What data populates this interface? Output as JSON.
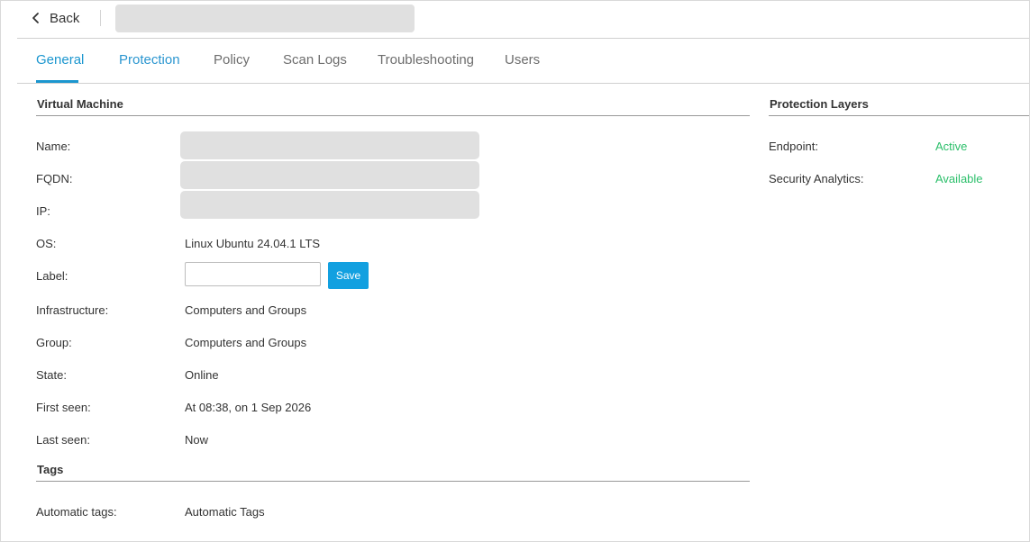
{
  "header": {
    "back_label": "Back"
  },
  "tabs": [
    {
      "label": "General"
    },
    {
      "label": "Protection"
    },
    {
      "label": "Policy"
    },
    {
      "label": "Scan Logs"
    },
    {
      "label": "Troubleshooting"
    },
    {
      "label": "Users"
    }
  ],
  "virtual_machine": {
    "title": "Virtual Machine",
    "name_label": "Name:",
    "fqdn_label": "FQDN:",
    "ip_label": "IP:",
    "os_label": "OS:",
    "os_value": "Linux Ubuntu 24.04.1 LTS",
    "label_label": "Label:",
    "label_value": "",
    "save_label": "Save",
    "infrastructure_label": "Infrastructure:",
    "infrastructure_value": "Computers and Groups",
    "group_label": "Group:",
    "group_value": "Computers and Groups",
    "state_label": "State:",
    "state_value": "Online",
    "first_seen_label": "First seen:",
    "first_seen_value": "At 08:38, on 1 Sep 2026",
    "last_seen_label": "Last seen:",
    "last_seen_value": "Now"
  },
  "tags": {
    "title": "Tags",
    "automatic_label": "Automatic tags:",
    "automatic_value": "Automatic Tags"
  },
  "protection_layers": {
    "title": "Protection Layers",
    "items": [
      {
        "label": "Endpoint:",
        "status": "Active"
      },
      {
        "label": "Security Analytics:",
        "status": "Available"
      }
    ]
  },
  "colors": {
    "accent": "#1b96cf",
    "save_button": "#12a0e0",
    "status_green": "#2bbf6a",
    "redacted_fill": "#e0e0e0"
  },
  "icons": {
    "back": "chevron-left-icon"
  }
}
